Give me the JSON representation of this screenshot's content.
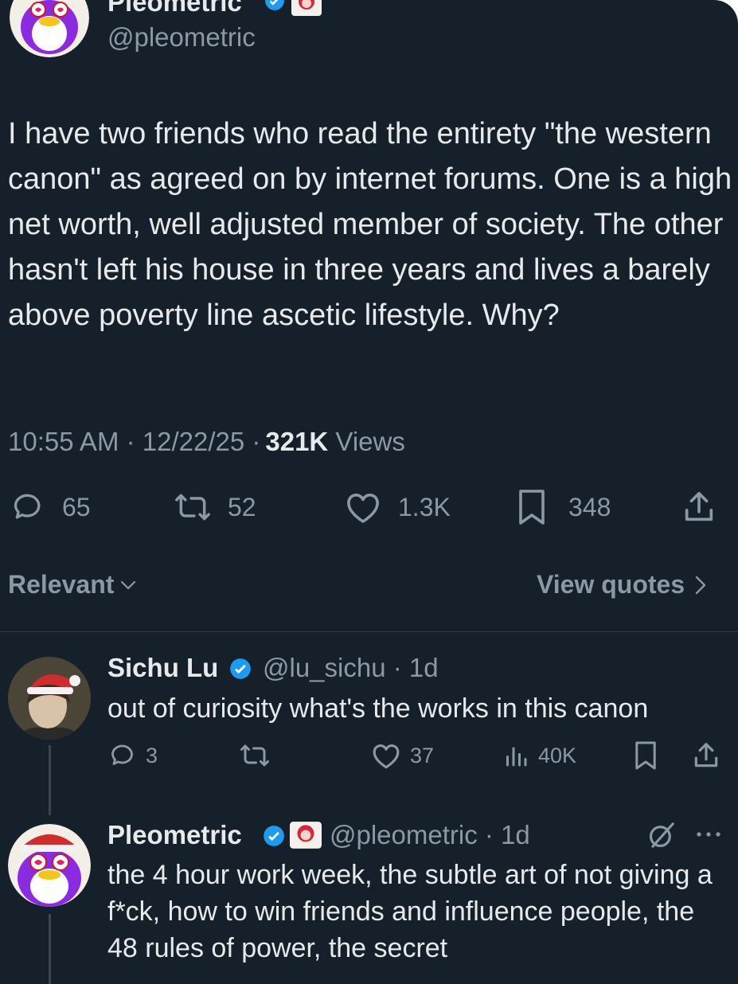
{
  "main_tweet": {
    "name": "Pleometric",
    "handle": "@pleometric",
    "text": "I have two friends who read the entirety \"the western canon\" as agreed on by internet forums. One is a high net worth, well adjusted member of society. The other hasn't left his house in three years and lives a barely above poverty line ascetic lifestyle. Why?",
    "time": "10:55 AM · 12/22/25 · ",
    "views_count": "321K",
    "views_label": " Views",
    "replies": "65",
    "reposts": "52",
    "likes": "1.3K",
    "bookmarks": "348"
  },
  "filter_bar": {
    "sort_label": "Relevant",
    "view_quotes_label": "View quotes"
  },
  "replies": [
    {
      "name": "Sichu Lu",
      "handle": "@lu_sichu · 1d",
      "text": "out of curiosity what's the works in this canon",
      "replies": "3",
      "likes": "37",
      "views": "40K"
    },
    {
      "name": "Pleometric",
      "handle": "@pleometric · 1d",
      "text": "the 4 hour work week, the subtle art of not giving a f*ck, how to win friends and influence people, the 48 rules of power, the secret"
    }
  ],
  "colors": {
    "background": "#15202b",
    "text": "#e7e9ea",
    "muted": "#8b98a5",
    "verified": "#1d9bf0",
    "avatar_purple": "#8a2be2"
  }
}
